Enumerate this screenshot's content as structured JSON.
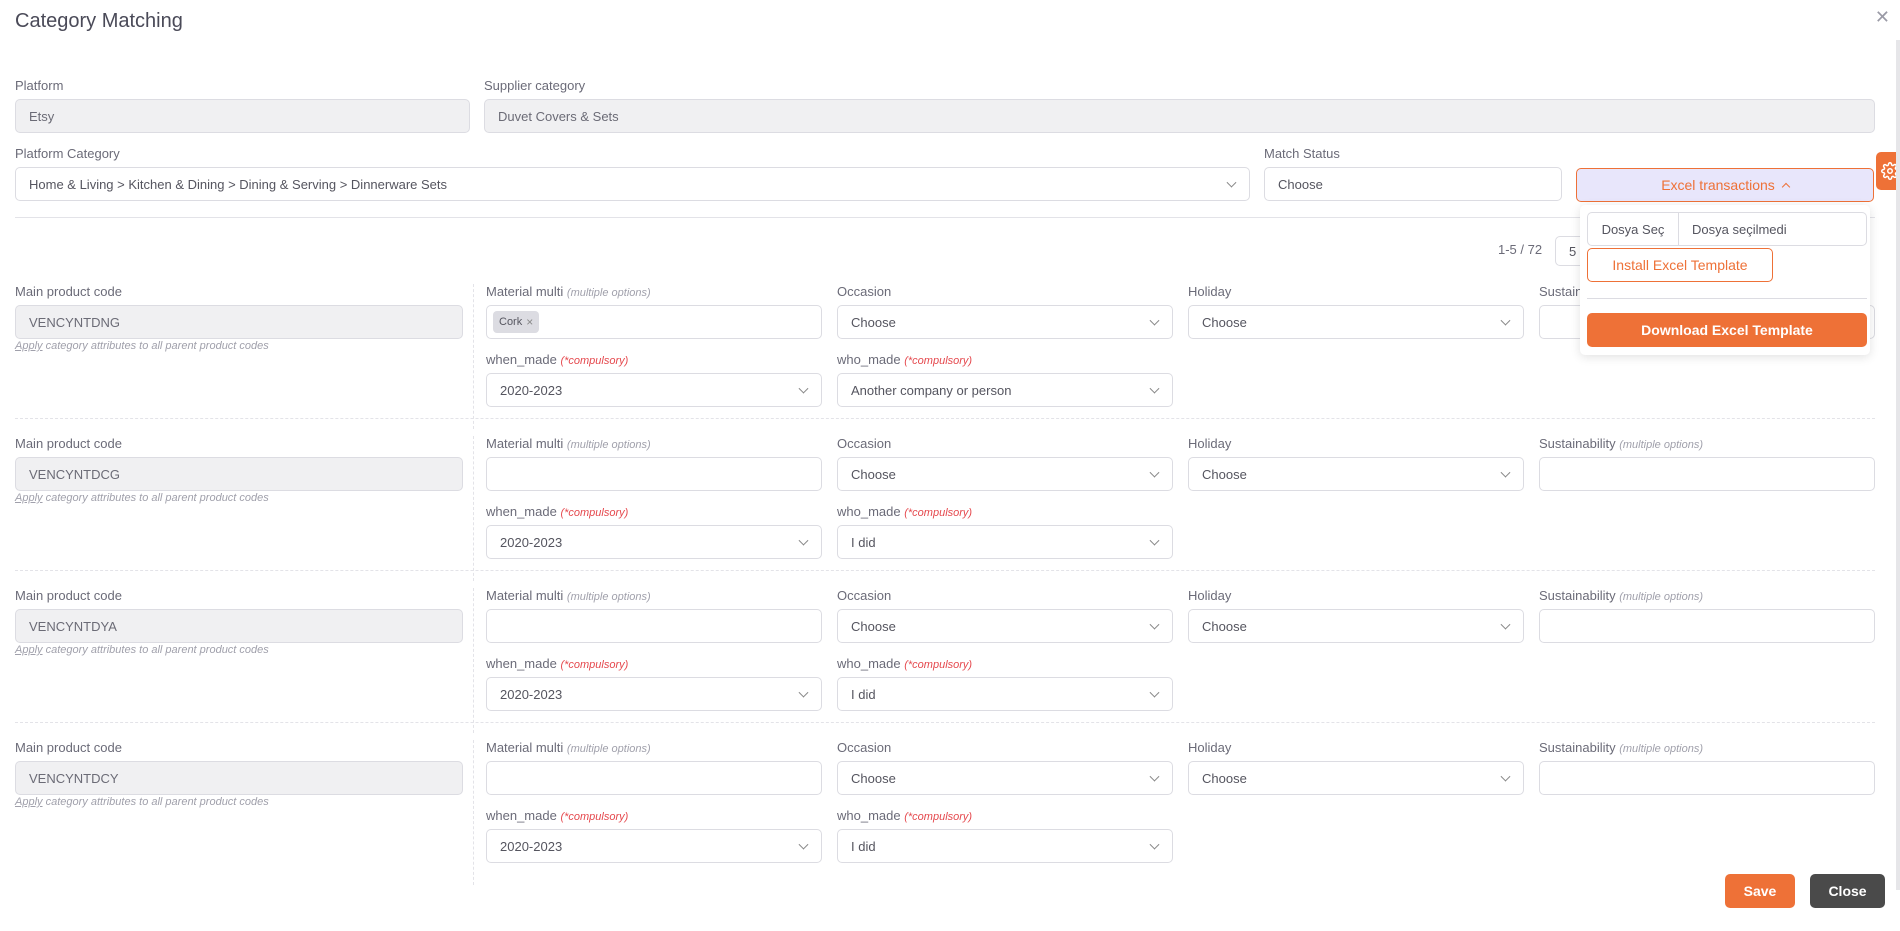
{
  "modal": {
    "title": "Category Matching",
    "close_icon": "close-icon"
  },
  "filters": {
    "platform": {
      "label": "Platform",
      "value": "Etsy"
    },
    "supplier_category": {
      "label": "Supplier category",
      "value": "Duvet Covers & Sets"
    },
    "platform_category": {
      "label": "Platform Category",
      "value": "Home & Living > Kitchen & Dining > Dining & Serving > Dinnerware Sets"
    },
    "match_status": {
      "label": "Match Status",
      "placeholder": "Choose"
    }
  },
  "excel": {
    "button_label": "Excel transactions",
    "file_button": "Dosya Seç",
    "file_name": "Dosya seçilmedi",
    "install_label": "Install Excel Template",
    "download_label": "Download Excel Template"
  },
  "pagination": {
    "range": "1-5 / 72",
    "page_size": "5"
  },
  "labels": {
    "main_code": "Main product code",
    "apply_link": "Apply",
    "apply_text": " category attributes to all parent product codes",
    "material": "Material multi",
    "occasion": "Occasion",
    "holiday": "Holiday",
    "sustainability": "Sustainability",
    "when_made": "when_made",
    "who_made": "who_made",
    "multiple_hint": "(multiple options)",
    "compulsory_hint": "(*compulsory)"
  },
  "rows": [
    {
      "code": "VENCYNTDNG",
      "material_chips": [
        "Cork"
      ],
      "occasion": "Choose",
      "holiday": "Choose",
      "sustainability": "",
      "when_made": "2020-2023",
      "who_made": "Another company or person"
    },
    {
      "code": "VENCYNTDCG",
      "material_chips": [],
      "occasion": "Choose",
      "holiday": "Choose",
      "sustainability": "",
      "when_made": "2020-2023",
      "who_made": "I did"
    },
    {
      "code": "VENCYNTDYA",
      "material_chips": [],
      "occasion": "Choose",
      "holiday": "Choose",
      "sustainability": "",
      "when_made": "2020-2023",
      "who_made": "I did"
    },
    {
      "code": "VENCYNTDCY",
      "material_chips": [],
      "occasion": "Choose",
      "holiday": "Choose",
      "sustainability": "",
      "when_made": "2020-2023",
      "who_made": "I did"
    }
  ],
  "footer": {
    "save_label": "Save",
    "close_label": "Close"
  },
  "colors": {
    "accent": "#ee7137",
    "dark_button": "#4a4a4a",
    "required": "#e5484d",
    "excel_button_bg": "#e8e6fb"
  }
}
